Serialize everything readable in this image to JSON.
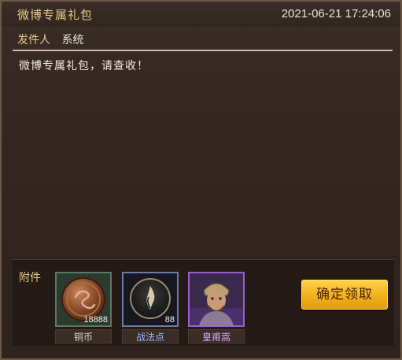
{
  "mail": {
    "title": "微博专属礼包",
    "date": "2021-06-21 17:24:06",
    "sender_label": "发件人",
    "sender_value": "系统",
    "body": "微博专属礼包，请查收！"
  },
  "attachments": {
    "label": "附件",
    "items": [
      {
        "name": "铜币",
        "count": "18888",
        "icon": "copper-coin-icon"
      },
      {
        "name": "战法点",
        "count": "88",
        "icon": "tactic-point-icon"
      },
      {
        "name": "皇甫嵩",
        "count": "",
        "icon": "general-portrait"
      }
    ],
    "confirm_label": "确定领取"
  },
  "colors": {
    "title": "#e6c98a",
    "frame_green": "#5b7a62",
    "frame_blue": "#6b7aa8",
    "frame_purple": "#9b5fcf",
    "button": "#f0b01c"
  }
}
